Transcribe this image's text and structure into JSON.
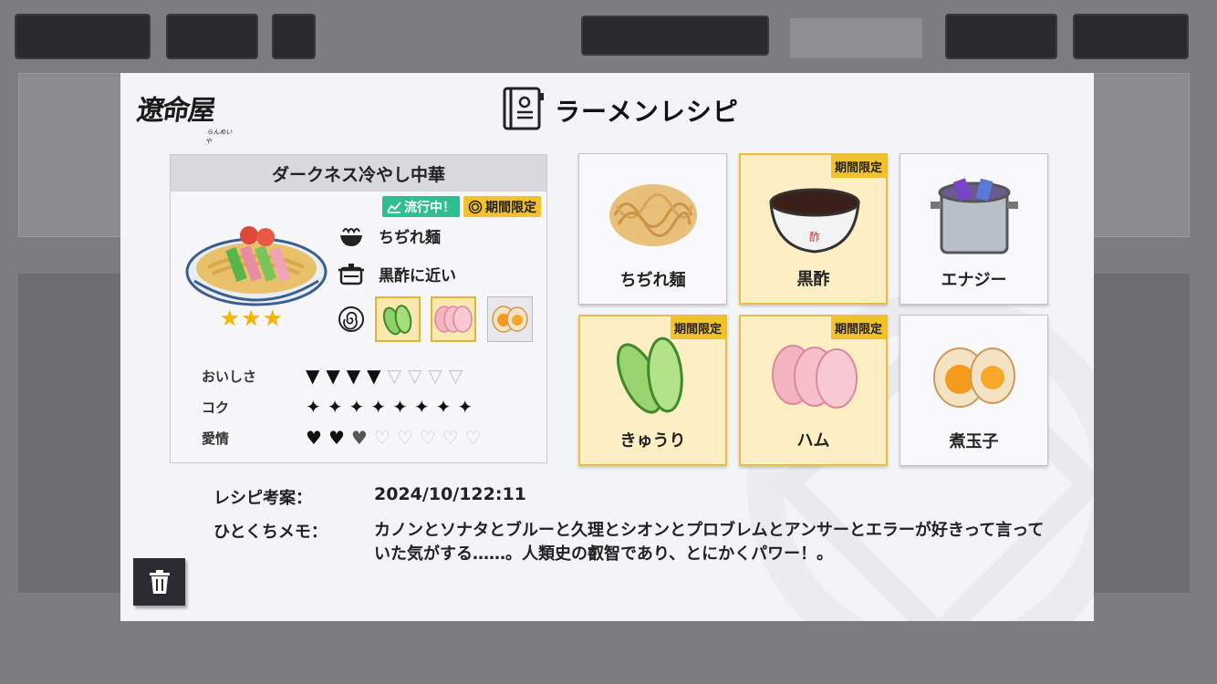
{
  "modal": {
    "logo_text": "遼命屋",
    "logo_sub": "らんめいや",
    "title": "ラーメンレシピ"
  },
  "recipe": {
    "name": "ダークネス冷やし中華",
    "badge_trend": "流行中！",
    "badge_limited": "期間限定",
    "star_rating": 3,
    "noodle": "ちぢれ麺",
    "soup": "黒酢に近い",
    "stats": [
      {
        "label": "おいしさ",
        "filled": 4,
        "total": 8,
        "icon": "bowl-icon"
      },
      {
        "label": "コク",
        "filled": 8,
        "total": 8,
        "icon": "sparkle-icon"
      },
      {
        "label": "愛情",
        "filled": 2.5,
        "total": 8,
        "icon": "heart-icon"
      }
    ]
  },
  "ingredients": [
    {
      "name": "ちぢれ麺",
      "limited": false,
      "icon": "noodles-icon"
    },
    {
      "name": "黒酢",
      "limited": true,
      "icon": "vinegar-bowl-icon"
    },
    {
      "name": "エナジー",
      "limited": false,
      "icon": "energy-pot-icon"
    },
    {
      "name": "きゅうり",
      "limited": true,
      "icon": "cucumber-icon"
    },
    {
      "name": "ハム",
      "limited": true,
      "icon": "ham-icon"
    },
    {
      "name": "煮玉子",
      "limited": false,
      "icon": "egg-icon"
    }
  ],
  "limited_tag": "期間限定",
  "info": {
    "date_label": "レシピ考案：",
    "date_value": "2024/10/122:11",
    "memo_label": "ひとくちメモ：",
    "memo_text": "カノンとソナタとブルーと久理とシオンとプロブレムとアンサーとエラーが好きって言っていた気がする……。人類史の叡智であり、とにかくパワー！。"
  },
  "colors": {
    "limited_bg": "#fdefc3",
    "limited_border": "#e8be47",
    "trend_badge": "#2dbf8f",
    "limited_badge": "#f2c12e"
  }
}
